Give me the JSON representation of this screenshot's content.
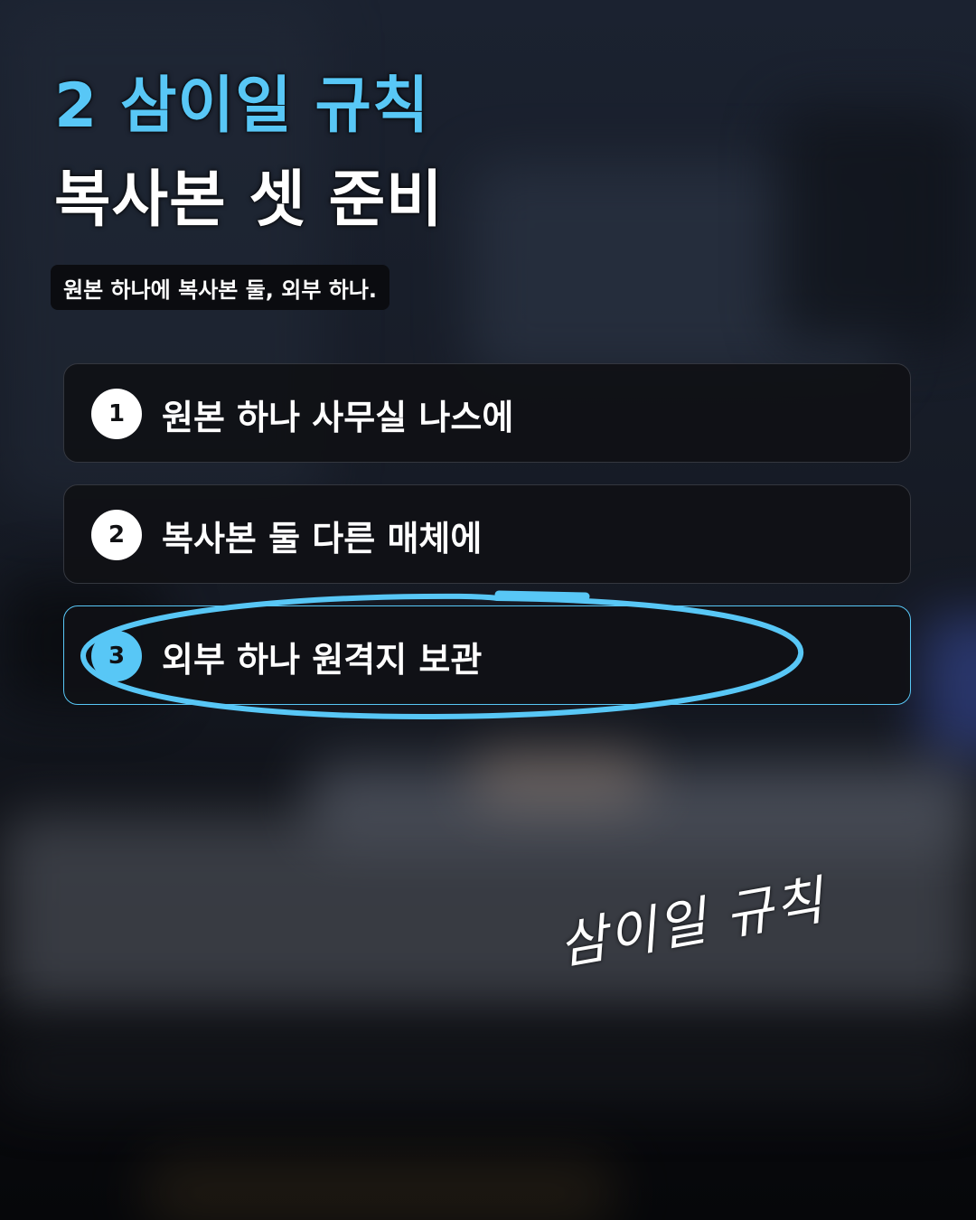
{
  "title": {
    "line1": "2 삼이일 규칙",
    "line2": "복사본 셋 준비"
  },
  "subtitle": "원본 하나에 복사본 둘, 외부 하나.",
  "steps": [
    {
      "number": "1",
      "text": "원본 하나 사무실 나스에"
    },
    {
      "number": "2",
      "text": "복사본 둘 다른 매체에"
    },
    {
      "number": "3",
      "text": "외부 하나 원격지 보관"
    }
  ],
  "handwritten_note": "삼이일 규칙",
  "colors": {
    "accent": "#58c7f6",
    "card_background": "#101115",
    "card_border": "#34373f",
    "text_primary": "#ffffff"
  }
}
